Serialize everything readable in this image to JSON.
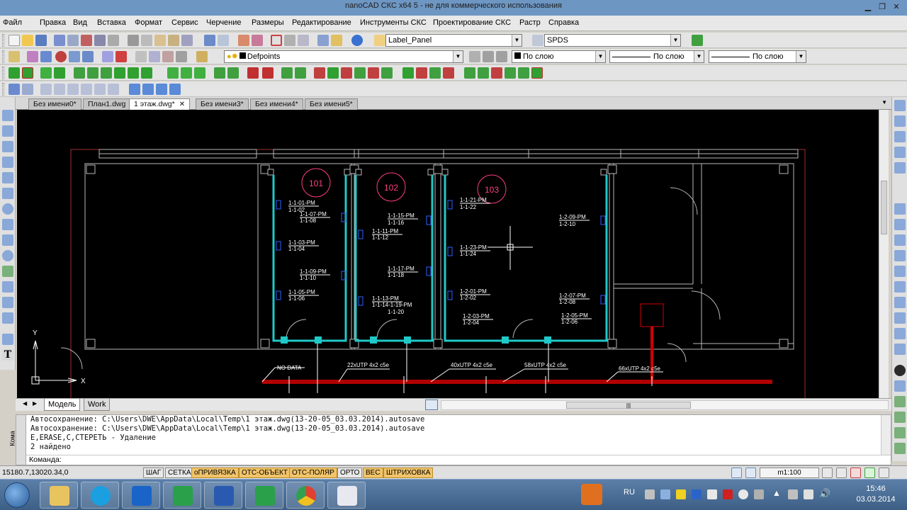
{
  "window": {
    "title": "nanoCAD СКС x64 5 - не для коммерческого использования"
  },
  "menu": [
    "Файл",
    "Правка",
    "Вид",
    "Вставка",
    "Формат",
    "Сервис",
    "Черчение",
    "Размеры",
    "Редактирование",
    "Инструменты СКС",
    "Проектирование СКС",
    "Растр",
    "Справка"
  ],
  "toolbar": {
    "label_panel": "Label_Panel",
    "spds": "SPDS",
    "layer": "Defpoints",
    "color": "По слою",
    "linetype": "По слою",
    "lineweight": "По слою"
  },
  "doc_tabs": [
    "Без имени0*",
    "План1.dwg",
    "1 этаж.dwg*",
    "Без имени3*",
    "Без имени4*",
    "Без имени5*"
  ],
  "doc_tab_close": "✕",
  "drawing": {
    "rooms": [
      "101",
      "102",
      "103"
    ],
    "outlets_101": [
      "1-1-01-PM",
      "1-1-02",
      "1-1-07-PM",
      "1-1-08",
      "1-1-03-PM",
      "1-1-04",
      "1-1-09-PM",
      "1-1-10",
      "1-1-05-PM",
      "1-1-06"
    ],
    "outlets_102": [
      "1-1-15-PM",
      "1-1-16",
      "1-1-11-PM",
      "1-1-12",
      "1-1-17-PM",
      "1-1-18",
      "1-1-13-PM",
      "1-1-14-1-19-PM",
      "1-1-20"
    ],
    "outlets_103": [
      "1-1-21-PM",
      "1-1-22",
      "1-1-23-PM",
      "1-1-24",
      "1-2-01-PM",
      "1-2-02",
      "1-2-03-PM",
      "1-2-04",
      "1-2-09-PM",
      "1-2-10",
      "1-2-07-PM",
      "1-2-08",
      "1-2-05-PM",
      "1-2-06"
    ],
    "cables": [
      "NO DATA",
      "22xUTP 4x2 c5e",
      "40xUTP 4x2 c5e",
      "58xUTP 4x2 c5e",
      "66xUTP 4x2 c5e"
    ],
    "ucs_y": "Y",
    "ucs_x": "X"
  },
  "layout_tabs": [
    "Модель",
    "Work"
  ],
  "command_history": [
    "Автосохранение: C:\\Users\\DWE\\AppData\\Local\\Temp\\1 этаж.dwg(13-20-05_03.03.2014).autosave",
    "Автосохранение: C:\\Users\\DWE\\AppData\\Local\\Temp\\1 этаж.dwg(13-20-05_03.03.2014).autosave",
    "E,ERASE,С,СТЕРЕТЬ - Удаление",
    "2 найдено"
  ],
  "command_side_label": "Кома",
  "command_prompt": "Команда:",
  "status": {
    "coords": "15180.7,13020.34,0",
    "toggles": [
      {
        "label": "ШАГ",
        "on": false
      },
      {
        "label": "СЕТКА",
        "on": false
      },
      {
        "label": "оПРИВЯЗКА",
        "on": true
      },
      {
        "label": "ОТС-ОБЪЕКТ",
        "on": true
      },
      {
        "label": "ОТС-ПОЛЯР",
        "on": true
      },
      {
        "label": "ОРТО",
        "on": false
      },
      {
        "label": "ВЕС",
        "on": true
      },
      {
        "label": "ШТРИХОВКА",
        "on": true
      }
    ],
    "scale": "m1:100"
  },
  "taskbar": {
    "lang": "RU",
    "time": "15:46",
    "date": "03.03.2014"
  },
  "colors": {
    "accent_on": "#f2c46a",
    "wall": "#b8b8b8",
    "cable_tray": "#d00000",
    "duct": "#20c8c8",
    "room_circle": "#ff3f7f"
  }
}
